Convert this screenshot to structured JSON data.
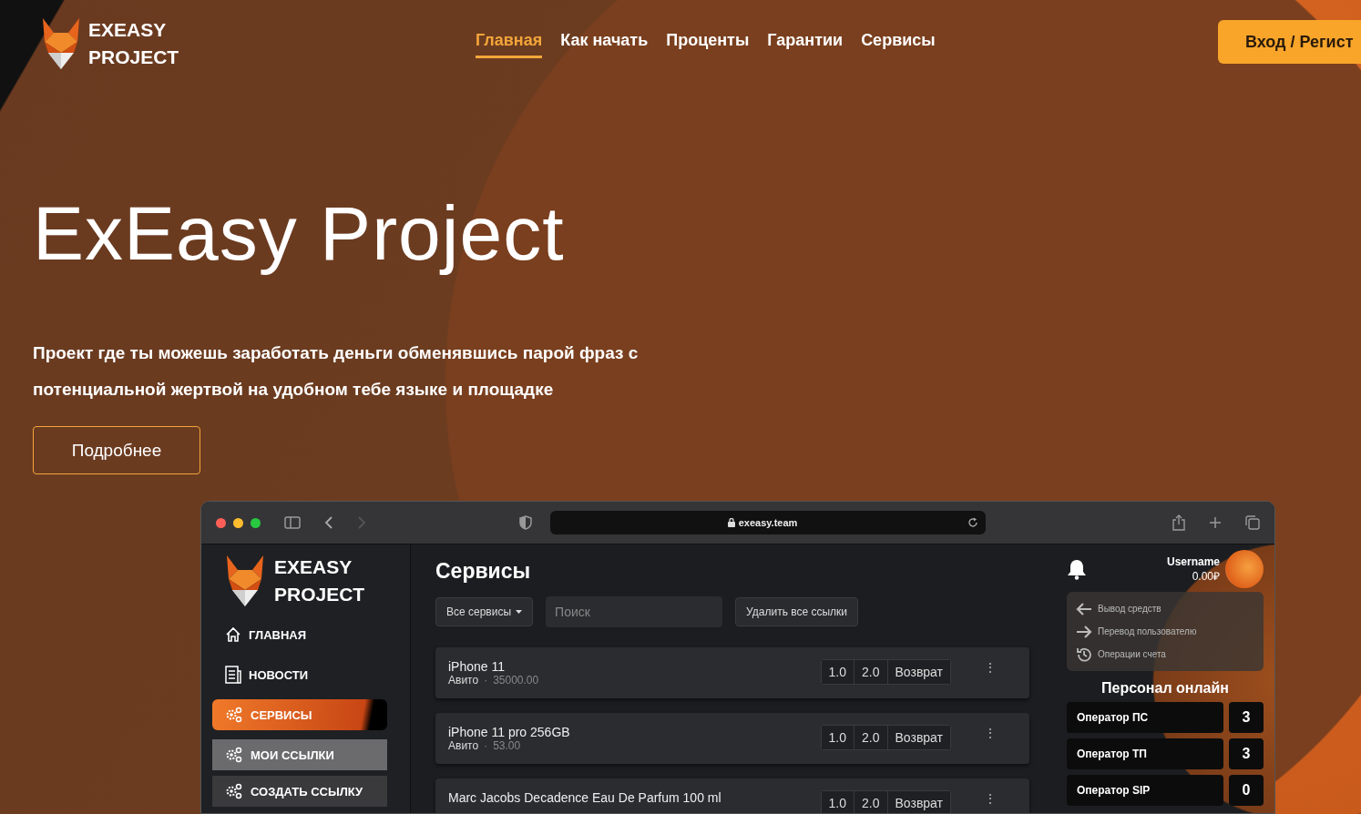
{
  "header": {
    "logo": [
      "EXEASY",
      "PROJECT"
    ],
    "nav": [
      {
        "label": "Главная",
        "selected": true
      },
      {
        "label": "Как начать",
        "selected": false
      },
      {
        "label": "Проценты",
        "selected": false
      },
      {
        "label": "Гарантии",
        "selected": false
      },
      {
        "label": "Сервисы",
        "selected": false
      }
    ],
    "login_button": "Вход / Регист"
  },
  "hero": {
    "title": "ExEasy Project",
    "text": "Проект где ты можешь заработать деньги обменявшись парой фраз с потенциальной жертвой на удобном тебе языке и площадке",
    "button": "Подробнее"
  },
  "browser": {
    "url": "exeasy.team",
    "sidebar": {
      "logo": [
        "EXEASY",
        "PROJECT"
      ],
      "items": [
        {
          "label": "ГЛАВНАЯ",
          "kind": "home",
          "selected": false,
          "highlighted": false
        },
        {
          "label": "НОВОСТИ",
          "kind": "news",
          "selected": false,
          "highlighted": false
        },
        {
          "label": "СЕРВИСЫ",
          "kind": "gears",
          "selected": true,
          "highlighted": false
        },
        {
          "label": "МОИ ССЫЛКИ",
          "kind": "gears-sub",
          "selected": false,
          "highlighted": true
        },
        {
          "label": "СОЗДАТЬ ССЫЛКУ",
          "kind": "gears-sub",
          "selected": false,
          "highlighted": false
        }
      ]
    },
    "main": {
      "title": "Сервисы",
      "filter": "Все сервисы",
      "search": {
        "placeholder": "Поиск"
      },
      "delete_button": "Удалить все ссылки",
      "items": [
        {
          "name": "iPhone 11",
          "platform": "Авито",
          "separator": "·",
          "price": "35000.00",
          "actions": [
            "1.0",
            "2.0",
            "Возврат"
          ],
          "menu": "⋮"
        },
        {
          "name": "iPhone 11 pro 256GB",
          "platform": "Авито",
          "separator": "·",
          "price": "53.00",
          "actions": [
            "1.0",
            "2.0",
            "Возврат"
          ],
          "menu": "⋮"
        },
        {
          "name": "Marc Jacobs Decadence Eau De Parfum 100 ml",
          "actions": [
            "1.0",
            "2.0",
            "Возврат"
          ],
          "menu": "⋮"
        }
      ]
    },
    "panel": {
      "username": "Username",
      "balance": "0.00₽",
      "menu": [
        {
          "label": "Вывод средств",
          "kind": "withdraw"
        },
        {
          "label": "Перевод пользователю",
          "kind": "transfer"
        },
        {
          "label": "Операции счета",
          "kind": "history"
        }
      ],
      "staff_title": "Персонал онлайн",
      "staff": [
        {
          "role": "Оператор ПС",
          "count": "3"
        },
        {
          "role": "Оператор ТП",
          "count": "3"
        },
        {
          "role": "Оператор SIP",
          "count": "0"
        }
      ]
    }
  }
}
